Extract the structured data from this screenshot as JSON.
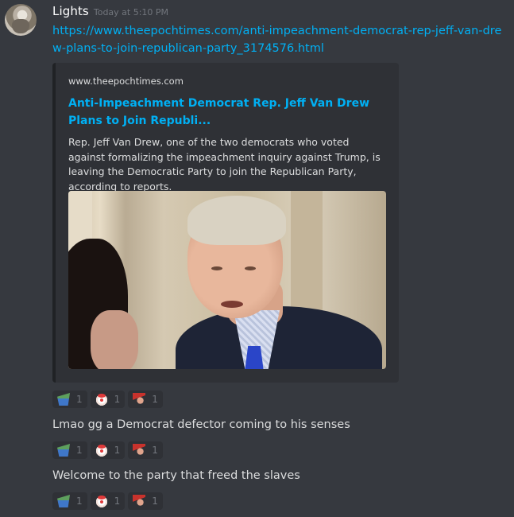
{
  "message": {
    "username": "Lights",
    "timestamp": "Today at 5:10 PM",
    "link": "https://www.theepochtimes.com/anti-impeachment-democrat-rep-jeff-van-drew-plans-to-join-republican-party_3174576.html"
  },
  "embed": {
    "provider": "www.theepochtimes.com",
    "title": "Anti-Impeachment Democrat Rep. Jeff Van Drew Plans to Join Republi...",
    "description": "Rep. Jeff Van Drew, one of the two democrats who voted against formalizing the impeachment inquiry against Trump, is leaving the Democratic Party to join the Republican Party, according to reports."
  },
  "reaction_groups": [
    {
      "items": [
        {
          "icon": "boat-emoji-icon",
          "count": "1"
        },
        {
          "icon": "clown-emoji-icon",
          "count": "1"
        },
        {
          "icon": "maga-hat-emoji-icon",
          "count": "1"
        }
      ]
    },
    {
      "items": [
        {
          "icon": "boat-emoji-icon",
          "count": "1"
        },
        {
          "icon": "clown-emoji-icon",
          "count": "1"
        },
        {
          "icon": "maga-hat-emoji-icon",
          "count": "1"
        }
      ]
    },
    {
      "items": [
        {
          "icon": "boat-emoji-icon",
          "count": "1"
        },
        {
          "icon": "clown-emoji-icon",
          "count": "1"
        },
        {
          "icon": "maga-hat-emoji-icon",
          "count": "1"
        }
      ]
    }
  ],
  "followups": [
    "Lmao gg a Democrat defector coming to his senses",
    "Welcome to the party that freed the slaves"
  ],
  "colors": {
    "background": "#36393f",
    "link": "#00b0f4",
    "embed_bg": "#2f3136",
    "username": "#ffffff",
    "muted": "#72767d"
  }
}
